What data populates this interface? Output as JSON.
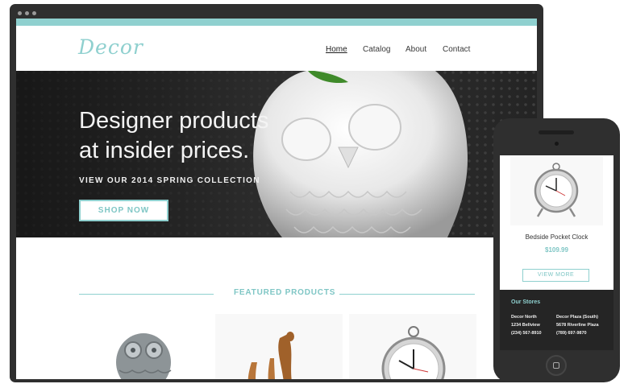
{
  "site": {
    "logo": "Decor",
    "nav": [
      {
        "label": "Home",
        "active": true
      },
      {
        "label": "Catalog",
        "active": false
      },
      {
        "label": "About",
        "active": false
      },
      {
        "label": "Contact",
        "active": false
      }
    ]
  },
  "hero": {
    "title": "Designer products at insider prices.",
    "subtitle": "VIEW OUR 2014 SPRING COLLECTION",
    "cta": "SHOP NOW"
  },
  "featured": {
    "title": "FEATURED PRODUCTS"
  },
  "mobile": {
    "product_name": "Bedside Pocket Clock",
    "product_price": "$109.99",
    "view_more": "VIEW MORE",
    "stores_title": "Our Stores",
    "stores": [
      {
        "name": "Decor North",
        "address": "1234 Bellview",
        "phone": "(234) 567-8910"
      },
      {
        "name": "Decor Plaza (South)",
        "address": "5678 Riverline Plaza",
        "phone": "(789) 697-9870"
      }
    ]
  },
  "colors": {
    "accent": "#8fd0cf",
    "frame": "#2f2f2f",
    "text_dark": "#333333"
  }
}
